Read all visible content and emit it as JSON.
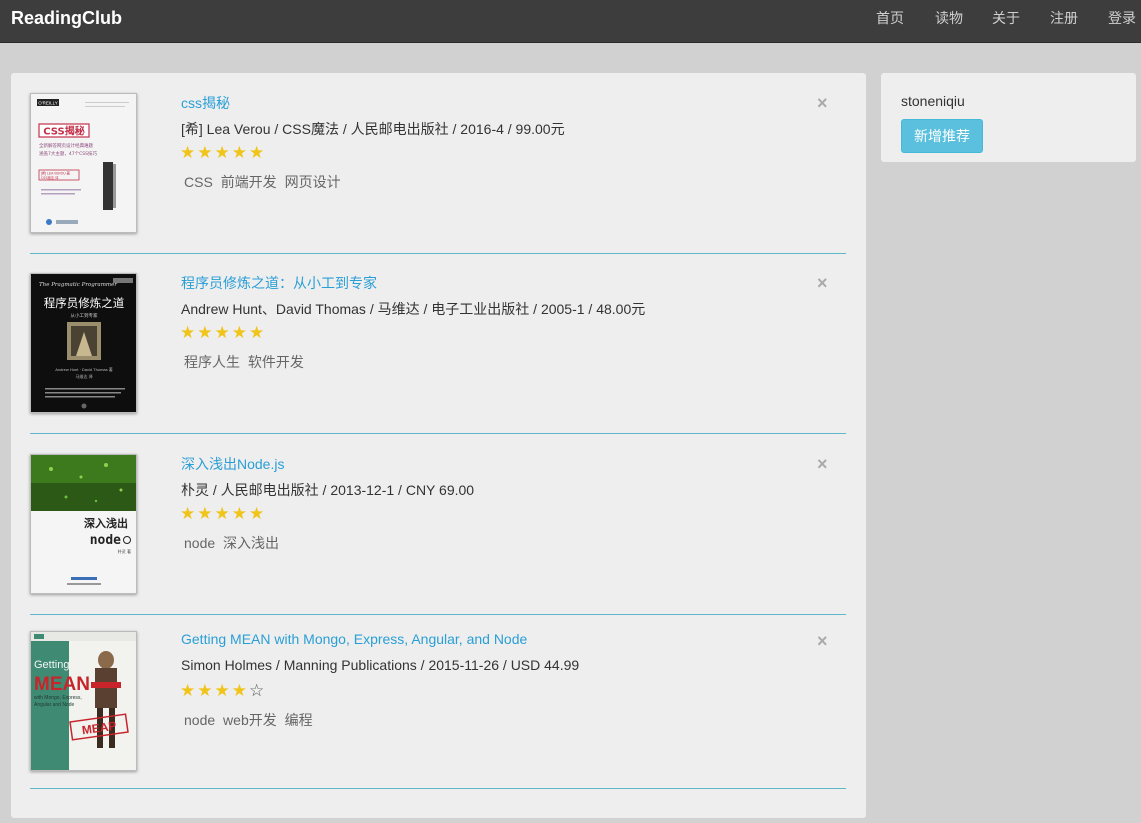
{
  "navbar": {
    "brand": "ReadingClub",
    "links": [
      "首页",
      "读物",
      "关于",
      "注册",
      "登录"
    ]
  },
  "sidebar": {
    "username": "stoneniqiu",
    "add_button_label": "新增推荐"
  },
  "close_symbol": "×",
  "colors": {
    "navbar_bg": "#3d3d3d",
    "link": "#2a9fd6",
    "star": "#f0c419",
    "button": "#5bc0de",
    "divider": "#5fb8c9"
  },
  "books": [
    {
      "title": "css揭秘",
      "meta": "[希] Lea Verou / CSS魔法 / 人民邮电出版社 / 2016-4 / 99.00元",
      "rating": 5,
      "tags": [
        "CSS",
        "前端开发",
        "网页设计"
      ],
      "cover": {
        "publisher_badge": "O'REILLY",
        "title": "CSS揭秘",
        "subtitle_lines": [
          "全新解答网页设计经典难题",
          "涵盖7大主题，47个CSS技巧"
        ],
        "author": "[希] LEA VEROU 著",
        "translator": "CSS魔法 译"
      }
    },
    {
      "title": "程序员修炼之道：从小工到专家",
      "meta": "Andrew Hunt、David Thomas / 马维达 / 电子工业出版社 / 2005-1 / 48.00元",
      "rating": 5,
      "tags": [
        "程序人生",
        "软件开发"
      ],
      "cover": {
        "series": "The Pragmatic Programmer",
        "title": "程序员修炼之道",
        "subtitle": "从小工到专家",
        "authors": "Andrew Hunt · David Thomas 著",
        "translator": "马维达 译"
      }
    },
    {
      "title": "深入浅出Node.js",
      "meta": "朴灵 / 人民邮电出版社 / 2013-12-1 / CNY 69.00",
      "rating": 5,
      "tags": [
        "node",
        "深入浅出"
      ],
      "cover": {
        "title": "深入浅出",
        "logo": "node",
        "author": "朴灵 著"
      }
    },
    {
      "title": "Getting MEAN with Mongo, Express, Angular, and Node",
      "meta": "Simon Holmes / Manning Publications / 2015-11-26 / USD 44.99",
      "rating": 4,
      "tags": [
        "node",
        "web开发",
        "编程"
      ],
      "cover": {
        "title_line1": "Getting",
        "title_line2": "MEAN",
        "subtitle_lines": [
          "with Mongo, Express,",
          "Angular and Node"
        ],
        "stamp": "MEAP"
      }
    }
  ]
}
